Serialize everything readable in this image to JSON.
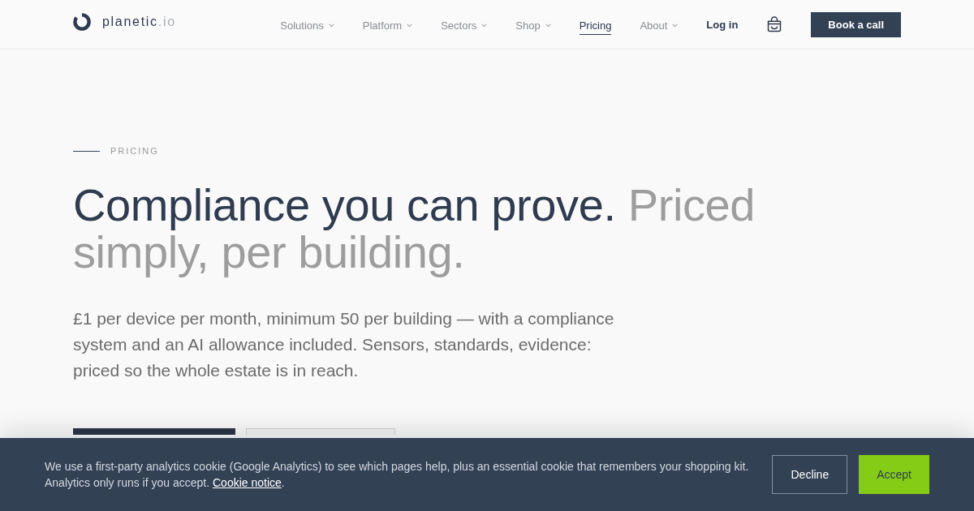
{
  "header": {
    "logo": {
      "name": "planetic",
      "suffix": ".io"
    },
    "nav": [
      {
        "label": "Solutions",
        "has_menu": true,
        "selected": false
      },
      {
        "label": "Platform",
        "has_menu": true,
        "selected": false
      },
      {
        "label": "Sectors",
        "has_menu": true,
        "selected": false
      },
      {
        "label": "Shop",
        "has_menu": true,
        "selected": false
      },
      {
        "label": "Pricing",
        "has_menu": false,
        "selected": true
      },
      {
        "label": "About",
        "has_menu": true,
        "selected": false
      }
    ],
    "login": "Log in",
    "cta": "Book a call"
  },
  "hero": {
    "eyebrow": "PRICING",
    "headline": [
      {
        "text": "Compliance you can prove.",
        "kind": "strong"
      },
      {
        "text": "Priced simply, per building.",
        "kind": "muted"
      }
    ],
    "lead": "£1 per device per month, minimum 50 per building — with a compliance system and an AI allowance included. Sensors, standards, evidence: priced so the whole estate is in reach.",
    "actions": [
      {
        "kind": "primary"
      },
      {
        "kind": "outline"
      }
    ]
  },
  "cookie_banner": {
    "text": "We use a first-party analytics cookie (Google Analytics) to see which pages help, plus an essential cookie that remembers your shopping kit. Analytics only runs if you accept.",
    "link": "Cookie notice",
    "after_link": ".",
    "buttons": [
      {
        "label": "Decline",
        "kind": "outline"
      },
      {
        "label": "Accept",
        "kind": "primary"
      }
    ]
  }
}
